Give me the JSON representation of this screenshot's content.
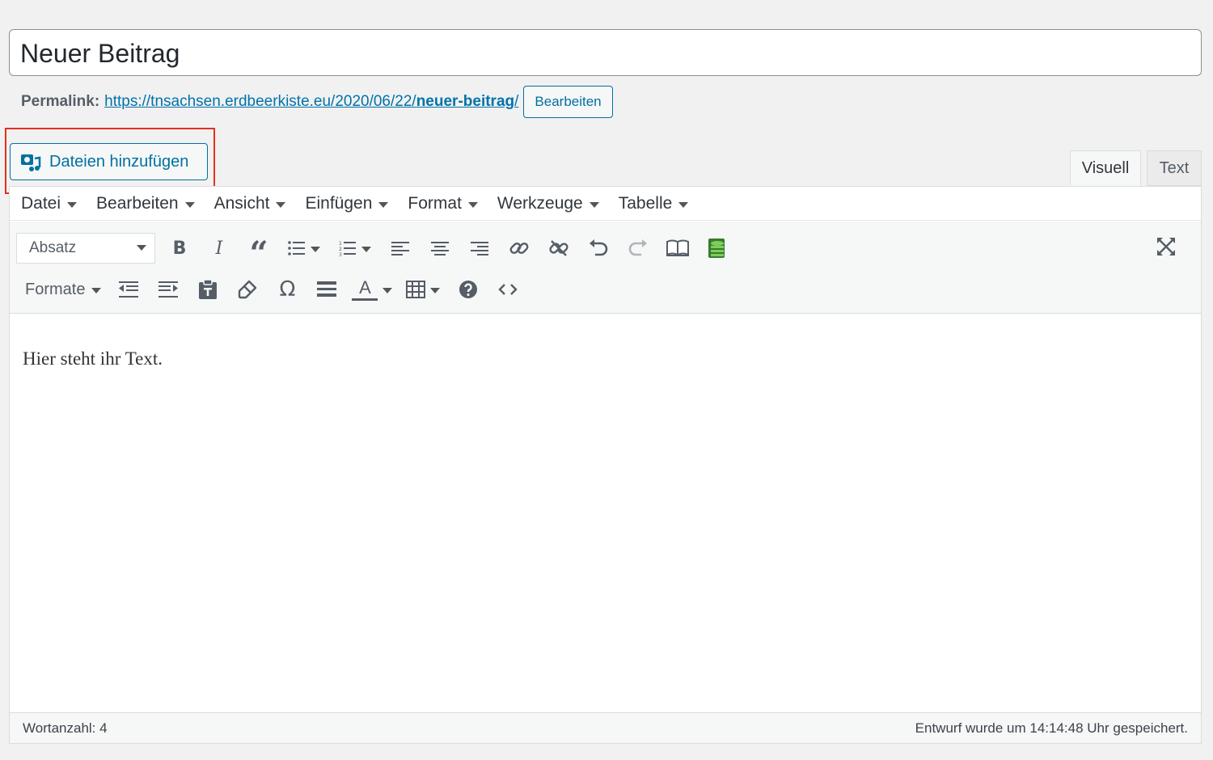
{
  "post": {
    "title": "Neuer Beitrag",
    "permalink_label": "Permalink:",
    "permalink_base": "https://tnsachsen.erdbeerkiste.eu/2020/06/22/",
    "permalink_slug": "neuer-beitrag",
    "permalink_trailing": "/",
    "edit_permalink_label": "Bearbeiten"
  },
  "media": {
    "add_media_label": "Dateien hinzufügen"
  },
  "tabs": {
    "visual": "Visuell",
    "text": "Text"
  },
  "menubar": [
    "Datei",
    "Bearbeiten",
    "Ansicht",
    "Einfügen",
    "Format",
    "Werkzeuge",
    "Tabelle"
  ],
  "toolbar": {
    "format_select": "Absatz",
    "formats_label": "Formate",
    "bold": "B",
    "italic": "I",
    "quote": "“",
    "omega": "Ω",
    "text_color": "A"
  },
  "content": {
    "paragraph": "Hier steht ihr Text."
  },
  "status": {
    "word_count": "Wortanzahl: 4",
    "autosave": "Entwurf wurde um 14:14:48 Uhr gespeichert."
  },
  "colors": {
    "accent": "#0071a1",
    "highlight": "#e5301d"
  }
}
